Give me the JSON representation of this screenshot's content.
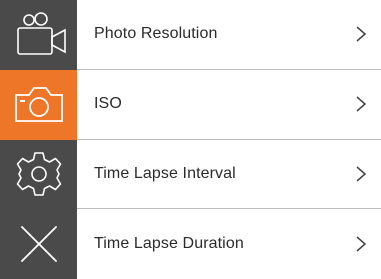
{
  "rail": {
    "items": [
      {
        "icon": "video-camera-icon",
        "active": false
      },
      {
        "icon": "photo-camera-icon",
        "active": true
      },
      {
        "icon": "gear-icon",
        "active": false
      },
      {
        "icon": "close-icon",
        "active": false
      }
    ]
  },
  "menu": {
    "items": [
      {
        "label": "Photo Resolution",
        "icon": "chevron-right-icon"
      },
      {
        "label": "ISO",
        "icon": "chevron-right-icon"
      },
      {
        "label": "Time Lapse Interval",
        "icon": "chevron-right-icon"
      },
      {
        "label": "Time Lapse Duration",
        "icon": "chevron-right-icon"
      }
    ]
  },
  "colors": {
    "rail_bg": "#4a4a4a",
    "accent": "#ee7628",
    "icon_stroke": "#ffffff",
    "divider": "#bdbdbd",
    "text": "#2b2b2b"
  }
}
